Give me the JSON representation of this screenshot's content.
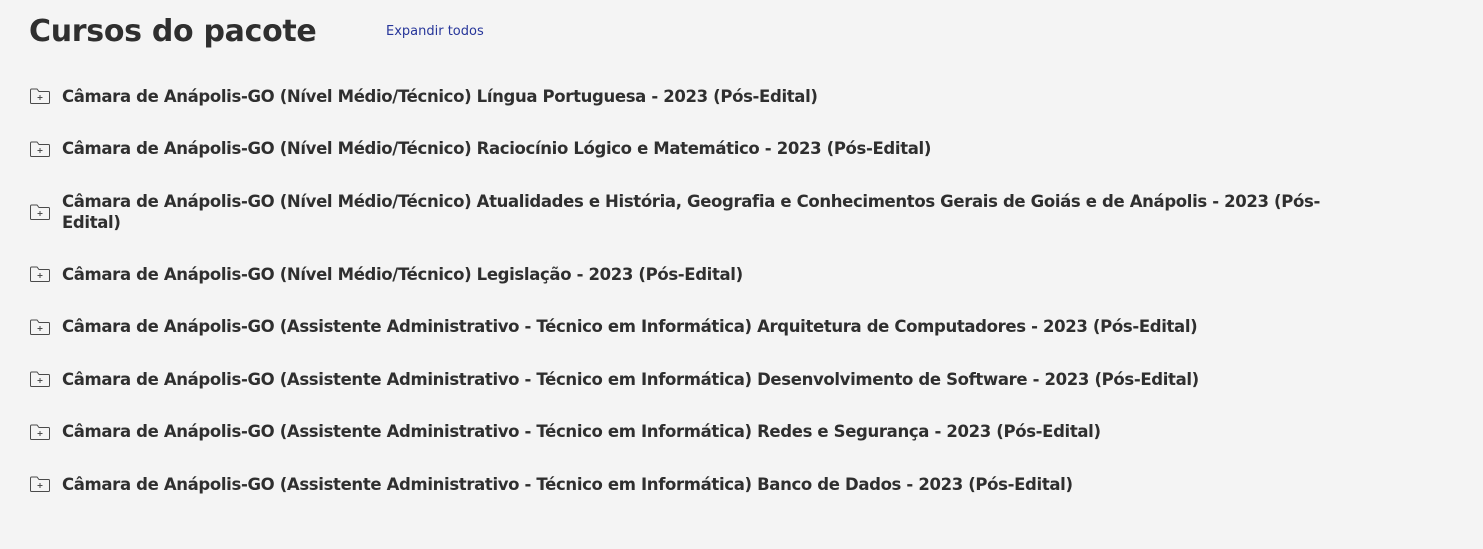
{
  "header": {
    "title": "Cursos do pacote",
    "expand_label": "Expandir todos"
  },
  "courses": [
    {
      "label": "Câmara de Anápolis-GO (Nível Médio/Técnico) Língua Portuguesa - 2023 (Pós-Edital)",
      "icon": "folder-plus-icon"
    },
    {
      "label": "Câmara de Anápolis-GO (Nível Médio/Técnico) Raciocínio Lógico e Matemático - 2023 (Pós-Edital)",
      "icon": "folder-plus-icon"
    },
    {
      "label": "Câmara de Anápolis-GO (Nível Médio/Técnico) Atualidades e História, Geografia e Conhecimentos Gerais de Goiás e de Anápolis - 2023 (Pós-Edital)",
      "icon": "folder-plus-icon"
    },
    {
      "label": "Câmara de Anápolis-GO (Nível Médio/Técnico) Legislação - 2023 (Pós-Edital)",
      "icon": "folder-plus-icon"
    },
    {
      "label": "Câmara de Anápolis-GO (Assistente Administrativo - Técnico em Informática) Arquitetura de Computadores - 2023 (Pós-Edital)",
      "icon": "folder-plus-icon"
    },
    {
      "label": "Câmara de Anápolis-GO (Assistente Administrativo - Técnico em Informática) Desenvolvimento de Software - 2023 (Pós-Edital)",
      "icon": "folder-plus-icon"
    },
    {
      "label": "Câmara de Anápolis-GO (Assistente Administrativo - Técnico em Informática) Redes e Segurança - 2023 (Pós-Edital)",
      "icon": "folder-plus-icon"
    },
    {
      "label": "Câmara de Anápolis-GO (Assistente Administrativo - Técnico em Informática) Banco de Dados - 2023 (Pós-Edital)",
      "icon": "folder-plus-icon"
    }
  ],
  "colors": {
    "background": "#f4f4f4",
    "text": "#2f2f2f",
    "link": "#27369a",
    "icon_stroke": "#4a4a4a"
  }
}
